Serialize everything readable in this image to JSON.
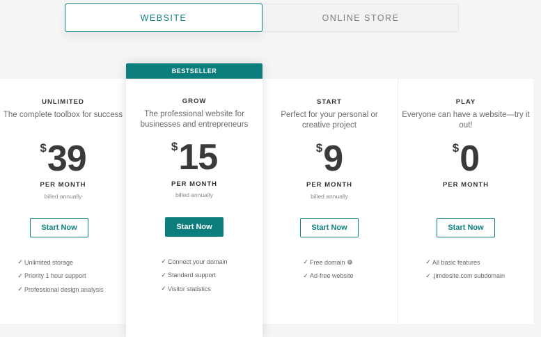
{
  "tabs": [
    {
      "label": "WEBSITE",
      "active": true
    },
    {
      "label": "ONLINE STORE",
      "active": false
    }
  ],
  "plans": {
    "unlimited": {
      "name": "UNLIMITED",
      "description": "The complete toolbox for success",
      "currency": "$",
      "price": "39",
      "period": "PER MONTH",
      "billing": "billed annually",
      "cta": "Start Now",
      "features": [
        "Unlimited storage",
        "Priority 1 hour support",
        "Professional design analysis"
      ]
    },
    "grow": {
      "ribbon": "BESTSELLER",
      "name": "GROW",
      "description": "The professional website for businesses and entrepreneurs",
      "currency": "$",
      "price": "15",
      "period": "PER MONTH",
      "billing": "billed annually",
      "cta": "Start Now",
      "features": [
        "Connect your domain",
        "Standard support",
        "Visitor statistics"
      ]
    },
    "start": {
      "name": "START",
      "description": "Perfect for your personal or creative project",
      "currency": "$",
      "price": "9",
      "period": "PER MONTH",
      "billing": "billed annually",
      "cta": "Start Now",
      "features": [
        "Free domain",
        "Ad-free website"
      ]
    },
    "play": {
      "name": "PLAY",
      "description": "Everyone can have a website—try it out!",
      "currency": "$",
      "price": "0",
      "period": "PER MONTH",
      "cta": "Start Now",
      "features": [
        "All basic features",
        ".jimdosite.com subdomain"
      ]
    }
  },
  "icons": {
    "check": "check-icon",
    "info": "info-icon"
  },
  "colors": {
    "accent": "#0d7e7e",
    "background": "#f5f5f5",
    "card": "#ffffff"
  }
}
